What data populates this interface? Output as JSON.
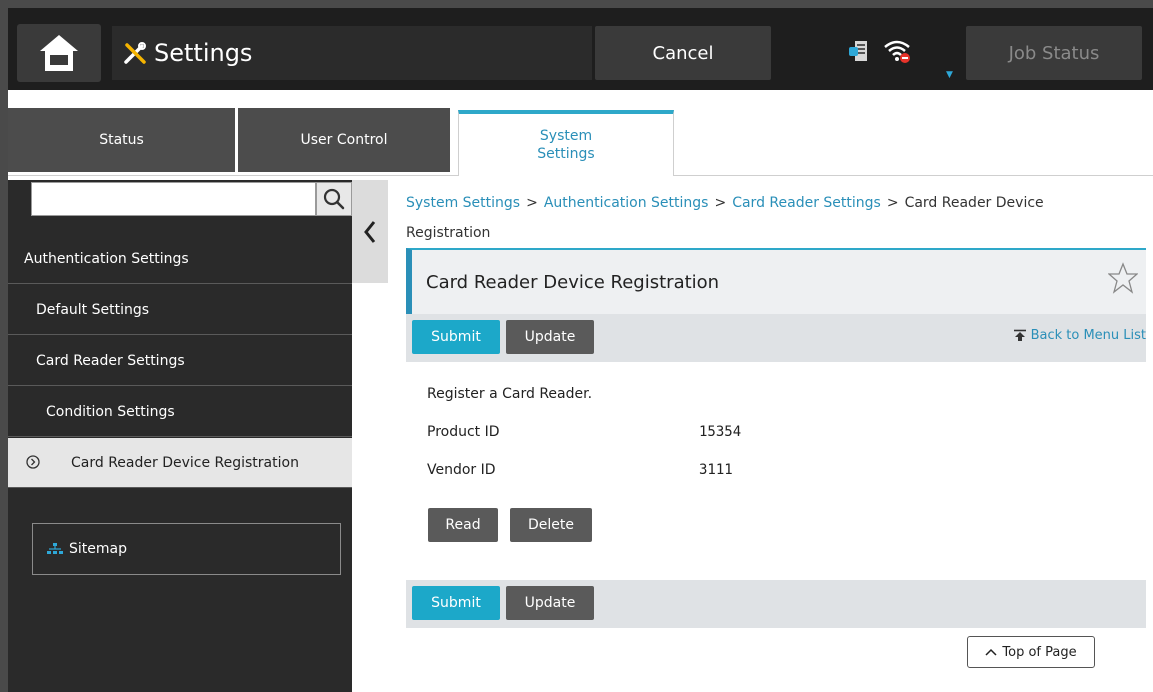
{
  "header": {
    "app_title": "Settings",
    "cancel_label": "Cancel",
    "job_status_label": "Job Status"
  },
  "tabs": [
    {
      "label": "Status"
    },
    {
      "label": "User Control"
    },
    {
      "label": "System Settings"
    }
  ],
  "sidebar": {
    "search_value": "",
    "items": [
      {
        "label": "Authentication Settings"
      },
      {
        "label": "Default Settings"
      },
      {
        "label": "Card Reader Settings"
      },
      {
        "label": "Condition Settings"
      },
      {
        "label": "Card Reader Device Registration"
      }
    ],
    "sitemap_label": "Sitemap"
  },
  "breadcrumb": {
    "items": [
      "System Settings",
      "Authentication Settings",
      "Card Reader Settings"
    ],
    "current": "Card Reader Device Registration",
    "separator": ">"
  },
  "panel": {
    "title": "Card Reader Device Registration",
    "submit_label": "Submit",
    "update_label": "Update",
    "back_label": "Back to Menu List",
    "intro": "Register a Card Reader.",
    "fields": [
      {
        "label": "Product ID",
        "value": "15354"
      },
      {
        "label": "Vendor ID",
        "value": "3111"
      }
    ],
    "read_label": "Read",
    "delete_label": "Delete",
    "top_of_page_label": "Top of Page"
  },
  "colors": {
    "accent": "#1ca8c9",
    "link": "#2a8fb8",
    "topbar": "#1e1e1e",
    "sidebar": "#2a2a2a"
  }
}
